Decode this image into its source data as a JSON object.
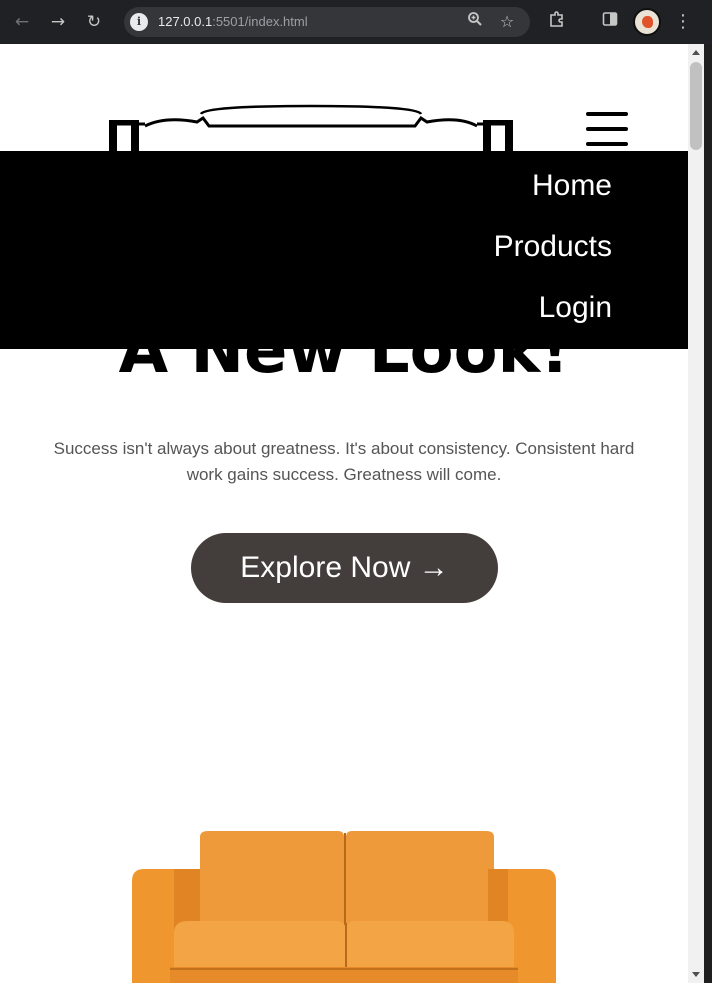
{
  "browser": {
    "url_host": "127.0.0.1",
    "url_path": ":5501/index.html",
    "icons": {
      "back": "arrow-left-icon",
      "forward": "arrow-right-icon",
      "reload": "reload-icon",
      "site_info": "info-icon",
      "zoom": "zoom-icon",
      "bookmark": "star-icon",
      "extensions": "puzzle-icon",
      "side_panel": "side-panel-icon",
      "menu": "kebab-menu-icon"
    }
  },
  "page": {
    "menu": {
      "items": [
        {
          "label": "Home"
        },
        {
          "label": "Products"
        },
        {
          "label": "Login"
        }
      ]
    },
    "hero": {
      "headline": "A New Look!",
      "tagline": "Success isn't always about greatness. It's about consistency. Consistent hard work gains success. Greatness will come.",
      "cta_label": "Explore Now →"
    }
  },
  "colors": {
    "dropdown_bg": "#000000",
    "cta_bg": "#433d3b",
    "sofa": "#f0962e"
  }
}
